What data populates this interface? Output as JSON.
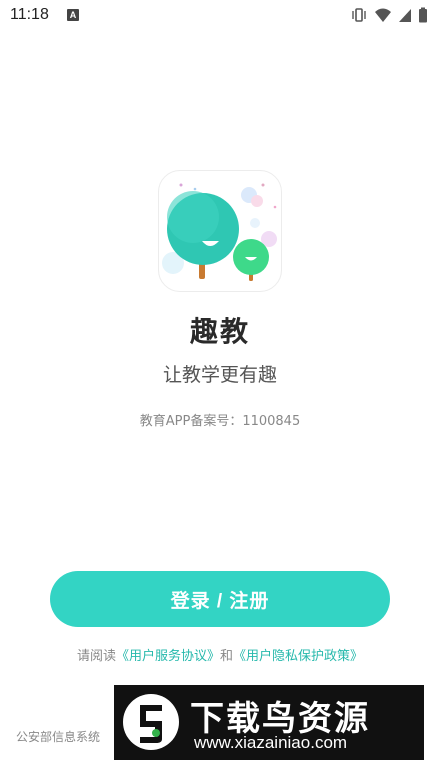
{
  "status_bar": {
    "time": "11:18",
    "notification_icon": "A",
    "icons": [
      "vibrate-icon",
      "wifi-icon",
      "signal-icon",
      "battery-icon"
    ]
  },
  "app": {
    "logo_icon": "tree-logo-icon",
    "name": "趣教",
    "slogan": "让教学更有趣",
    "record_label": "教育APP备案号：",
    "record_number": "1100845"
  },
  "login": {
    "button_label": "登录 / 注册"
  },
  "agreement": {
    "prefix": "请阅读",
    "user_agreement": "《用户服务协议》",
    "conjunction": "和",
    "privacy_policy": "《用户隐私保护政策》"
  },
  "footer": {
    "text": "公安部信息系统"
  },
  "watermark": {
    "title": "下载鸟资源",
    "url": "www.xiazainiao.com"
  },
  "colors": {
    "accent": "#33d4c4",
    "link": "#26b9ac",
    "tree_big": "#2fc7b3",
    "tree_small": "#3ed98a"
  }
}
